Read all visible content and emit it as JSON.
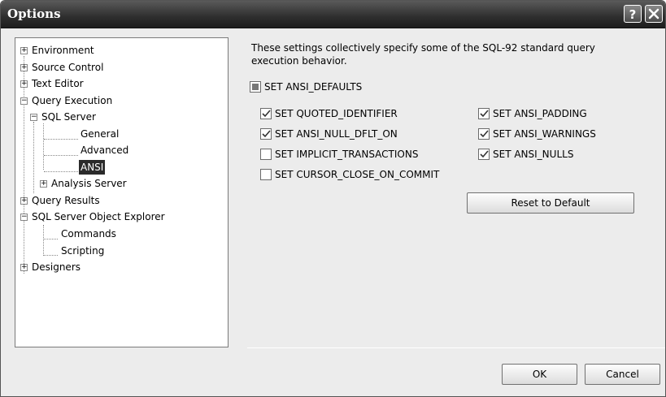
{
  "window": {
    "title": "Options"
  },
  "tree": {
    "environment": "Environment",
    "source_control": "Source Control",
    "text_editor": "Text Editor",
    "query_execution": "Query Execution",
    "sql_server": "SQL Server",
    "general": "General",
    "advanced": "Advanced",
    "ansi": "ANSI",
    "analysis_server": "Analysis Server",
    "query_results": "Query Results",
    "object_explorer": "SQL Server Object Explorer",
    "commands": "Commands",
    "scripting": "Scripting",
    "designers": "Designers"
  },
  "description": "These settings collectively specify some of the SQL-92 standard query execution behavior.",
  "options": {
    "ansi_defaults": {
      "label": "SET ANSI_DEFAULTS",
      "state": "indeterminate"
    },
    "quoted_identifier": {
      "label": "SET QUOTED_IDENTIFIER",
      "checked": true
    },
    "ansi_null_dflt_on": {
      "label": "SET ANSI_NULL_DFLT_ON",
      "checked": true
    },
    "implicit_transactions": {
      "label": "SET IMPLICIT_TRANSACTIONS",
      "checked": false
    },
    "cursor_close_on_commit": {
      "label": "SET CURSOR_CLOSE_ON_COMMIT",
      "checked": false
    },
    "ansi_padding": {
      "label": "SET ANSI_PADDING",
      "checked": true
    },
    "ansi_warnings": {
      "label": "SET ANSI_WARNINGS",
      "checked": true
    },
    "ansi_nulls": {
      "label": "SET ANSI_NULLS",
      "checked": true
    }
  },
  "buttons": {
    "reset": "Reset to Default",
    "ok": "OK",
    "cancel": "Cancel"
  },
  "icons": {
    "help": "help-icon",
    "close": "close-icon",
    "expand": "plus-icon",
    "collapse": "minus-icon",
    "check": "checkmark-icon"
  }
}
